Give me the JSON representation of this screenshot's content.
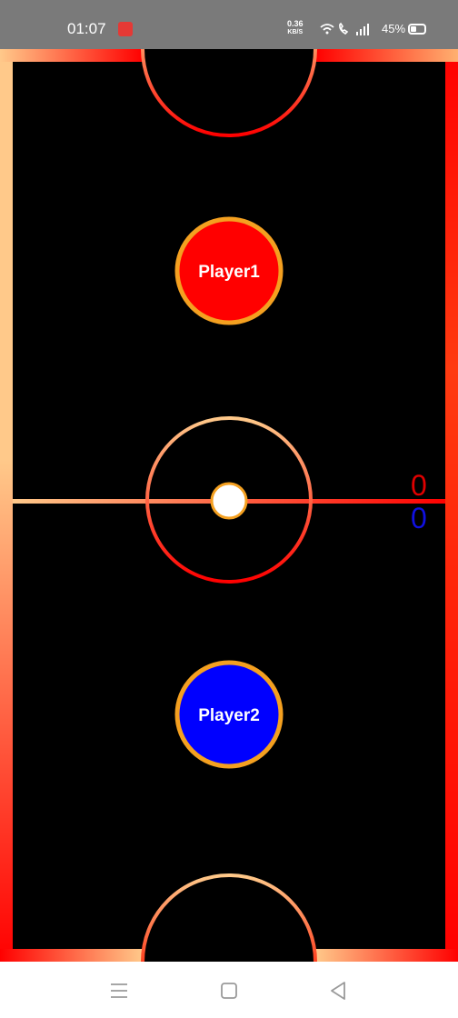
{
  "status_bar": {
    "time": "01:07",
    "speed_value": "0.36",
    "speed_unit": "KB/S",
    "battery": "45%"
  },
  "game": {
    "player1_label": "Player1",
    "player2_label": "Player2",
    "player1_score": "0",
    "player2_score": "0",
    "colors": {
      "player1": "#ff0000",
      "player2": "#0000ff",
      "mallet_border": "#f4a020",
      "puck": "#ffffff",
      "rink_light": "#ffc98a",
      "rink_dark": "#ff0000"
    }
  },
  "nav_bar": {
    "icons": [
      "menu-icon",
      "home-icon",
      "back-icon"
    ]
  }
}
